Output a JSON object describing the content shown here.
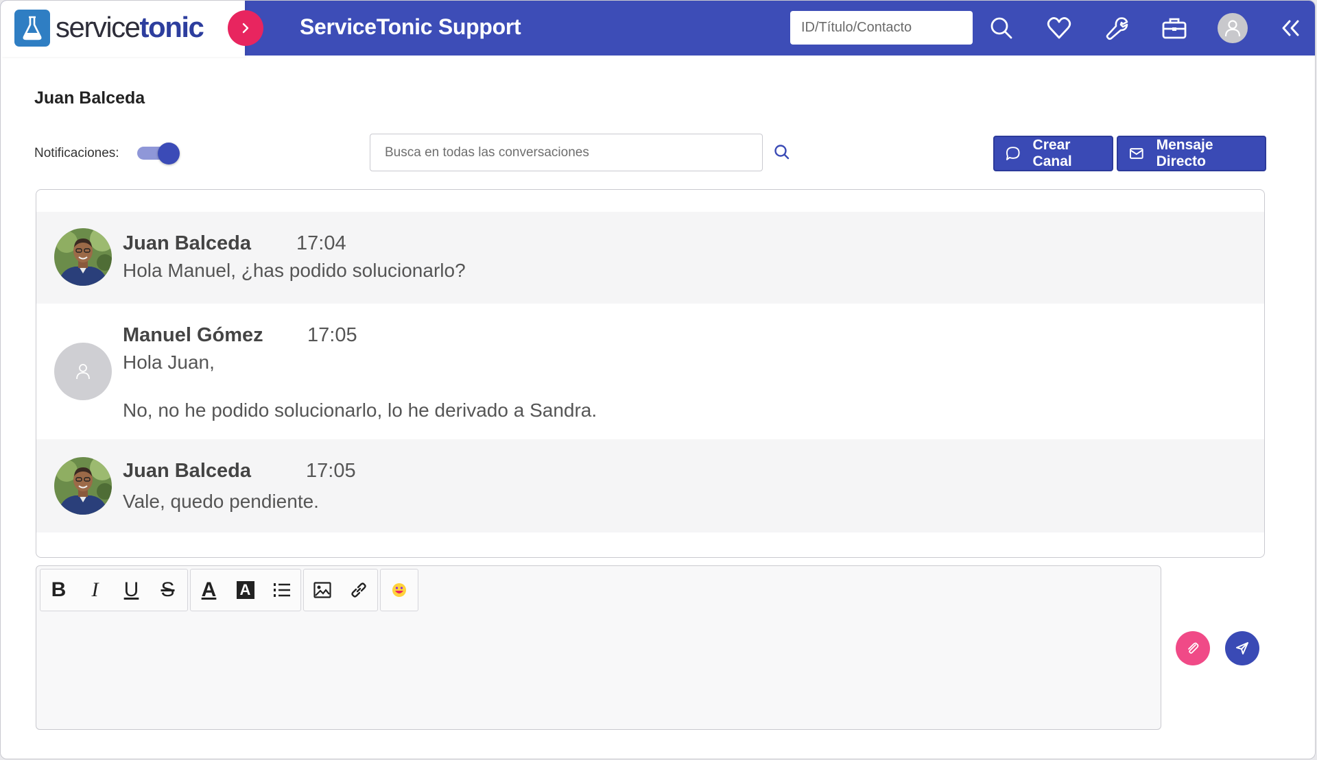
{
  "brand": {
    "name_light": "service",
    "name_bold": "tonic"
  },
  "header": {
    "title": "ServiceTonic Support",
    "search_placeholder": "ID/Título/Contacto"
  },
  "page": {
    "title": "Juan Balceda"
  },
  "notifications": {
    "label": "Notificaciones:",
    "enabled": true
  },
  "conversation_search": {
    "placeholder": "Busca en todas las conversaciones"
  },
  "actions": {
    "create_channel": "Crear Canal",
    "direct_message": "Mensaje Directo"
  },
  "messages": [
    {
      "author": "Juan Balceda",
      "time": "17:04",
      "lines": [
        "Hola Manuel, ¿has podido solucionarlo?"
      ]
    },
    {
      "author": "Manuel Gómez",
      "time": "17:05",
      "lines": [
        "Hola Juan,",
        "No, no he podido solucionarlo, lo he derivado a Sandra."
      ]
    },
    {
      "author": "Juan Balceda",
      "time": "17:05",
      "lines": [
        "Vale, quedo pendiente."
      ]
    }
  ],
  "editor": {
    "toolbar": {
      "bold": "B",
      "italic": "I",
      "underline": "U",
      "strikethrough": "S",
      "text_color": "A",
      "background_color": "A"
    }
  },
  "colors": {
    "header_bg": "#3d4db7",
    "accent": "#3a4ab5",
    "toggle_pink": "#e8255f",
    "attach_pink": "#f04a87"
  }
}
